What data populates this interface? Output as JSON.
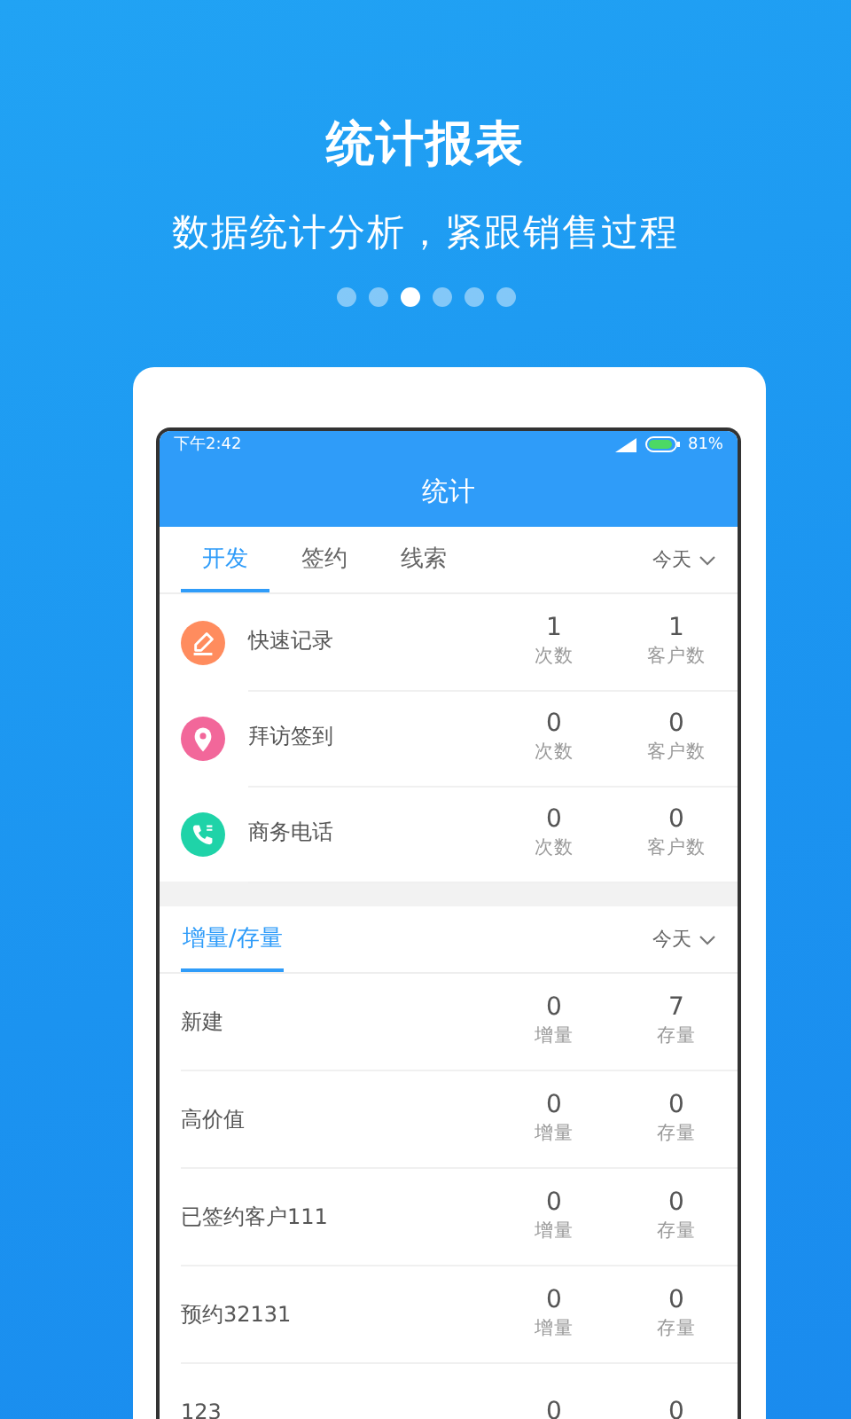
{
  "title": "统计报表",
  "subtitle": "数据统计分析，紧跟销售过程",
  "pager": [
    {
      "selected": false
    },
    {
      "selected": false
    },
    {
      "selected": true
    },
    {
      "selected": false
    },
    {
      "selected": false
    },
    {
      "selected": false
    }
  ],
  "phone": {
    "status_bar": {
      "time": "下午2:42",
      "battery": "81%"
    },
    "header": "统计",
    "tabs": [
      {
        "label": "开发",
        "selected": true
      },
      {
        "label": "签约",
        "selected": false
      },
      {
        "label": "线索",
        "selected": false
      }
    ],
    "filter": "今天",
    "activities": [
      {
        "kind": "edit",
        "name": "快速记录",
        "stats": [
          {
            "value": "1",
            "label": "次数"
          },
          {
            "value": "1",
            "label": "客户数"
          }
        ]
      },
      {
        "kind": "pin",
        "name": "拜访签到",
        "stats": [
          {
            "value": "0",
            "label": "次数"
          },
          {
            "value": "0",
            "label": "客户数"
          }
        ]
      },
      {
        "kind": "phone",
        "name": "商务电话",
        "stats": [
          {
            "value": "0",
            "label": "次数"
          },
          {
            "value": "0",
            "label": "客户数"
          }
        ]
      }
    ],
    "section_tabs": [
      {
        "label": "增量/存量",
        "selected": true
      }
    ],
    "section_filter": "今天",
    "stages": [
      {
        "name": "新建",
        "stats": [
          {
            "value": "0",
            "label": "增量"
          },
          {
            "value": "7",
            "label": "存量"
          }
        ]
      },
      {
        "name": "高价值",
        "stats": [
          {
            "value": "0",
            "label": "增量"
          },
          {
            "value": "0",
            "label": "存量"
          }
        ]
      },
      {
        "name": "已签约客户111",
        "stats": [
          {
            "value": "0",
            "label": "增量"
          },
          {
            "value": "0",
            "label": "存量"
          }
        ]
      },
      {
        "name": "预约32131",
        "stats": [
          {
            "value": "0",
            "label": "增量"
          },
          {
            "value": "0",
            "label": "存量"
          }
        ]
      },
      {
        "name": "123",
        "stats": [
          {
            "value": "0"
          },
          {
            "value": "0"
          }
        ]
      }
    ]
  }
}
